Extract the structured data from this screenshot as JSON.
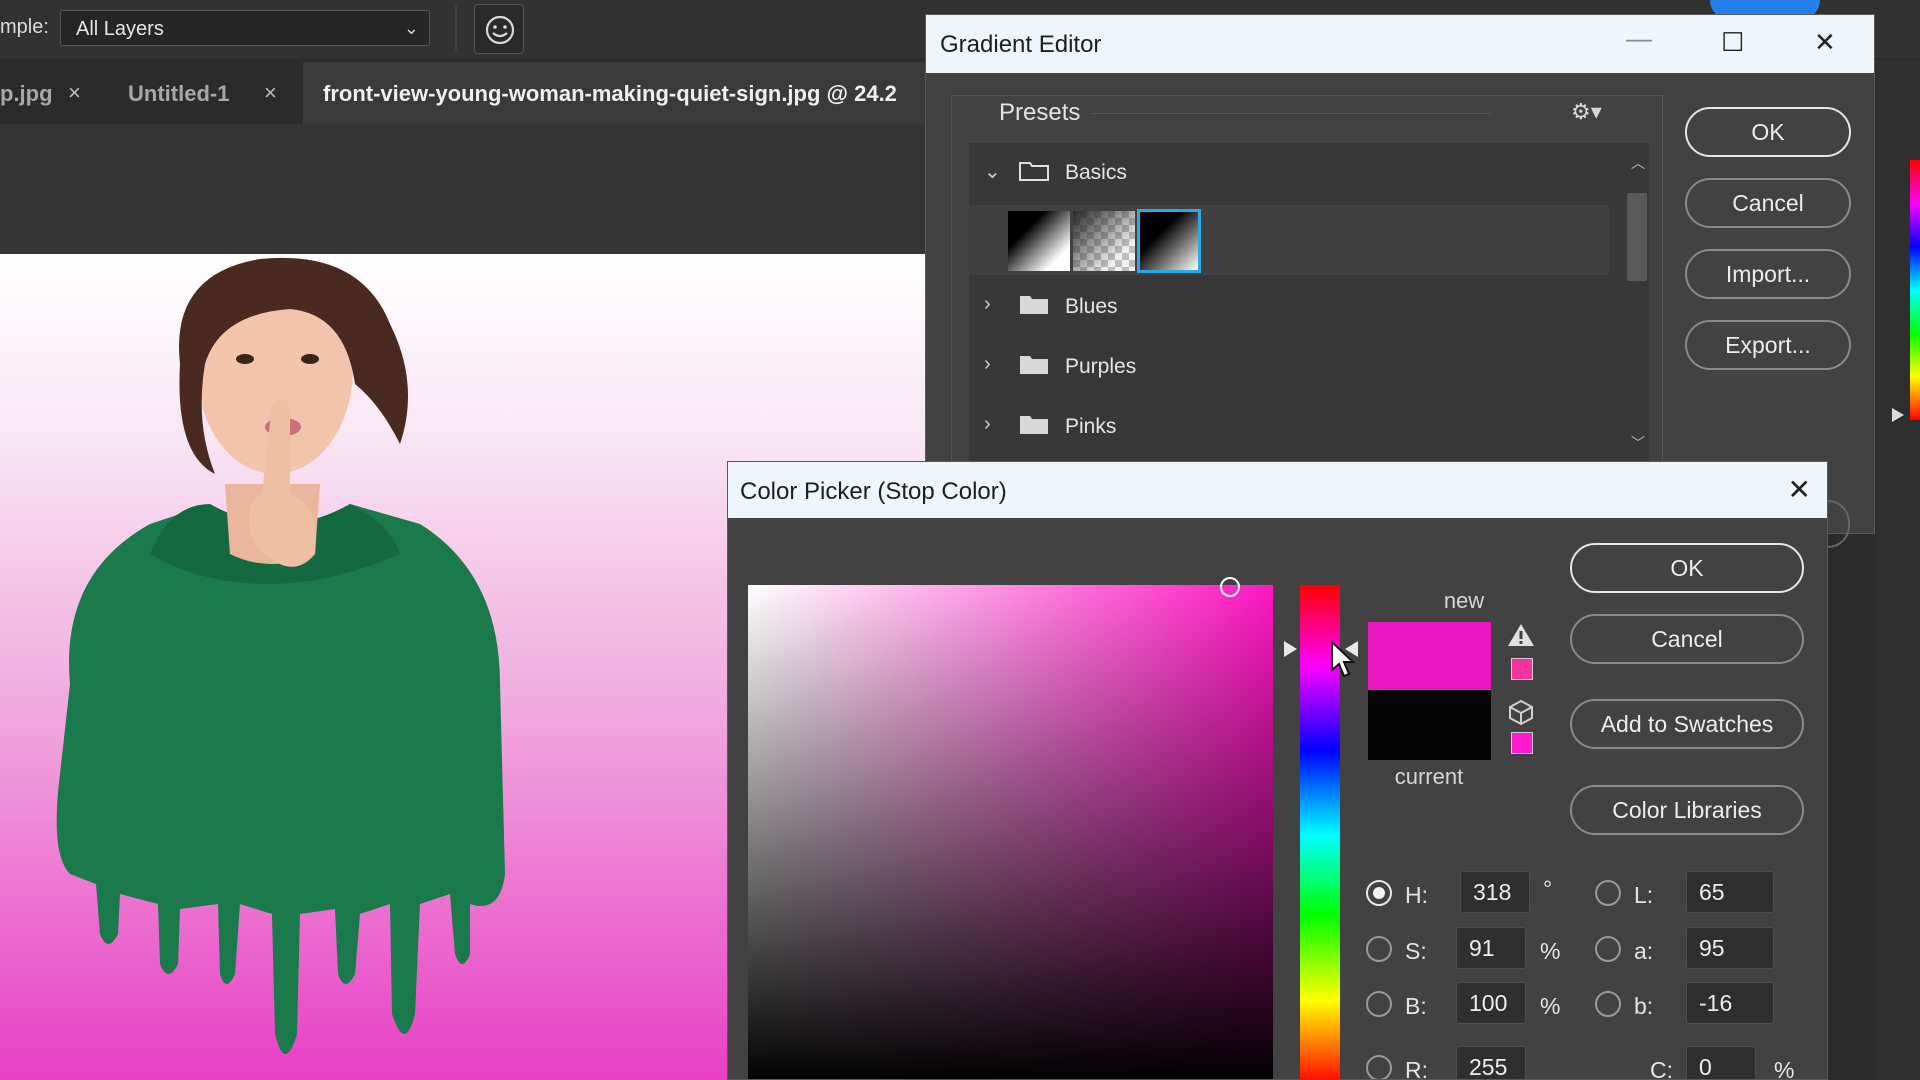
{
  "options_bar": {
    "sample_label": "mple:",
    "layers_select_value": "All Layers"
  },
  "tabs": [
    {
      "label": "p.jpg",
      "close": "×"
    },
    {
      "label": "Untitled-1",
      "close": "×"
    },
    {
      "label": "front-view-young-woman-making-quiet-sign.jpg @ 24.2"
    }
  ],
  "gradient_editor": {
    "title": "Gradient Editor",
    "presets_label": "Presets",
    "folders": [
      {
        "label": "Basics",
        "expanded": true
      },
      {
        "label": "Blues",
        "expanded": false
      },
      {
        "label": "Purples",
        "expanded": false
      },
      {
        "label": "Pinks",
        "expanded": false
      }
    ],
    "buttons": {
      "ok": "OK",
      "cancel": "Cancel",
      "import": "Import...",
      "export": "Export..."
    }
  },
  "color_picker": {
    "title": "Color Picker (Stop Color)",
    "new_label": "new",
    "current_label": "current",
    "new_color": "#e817c0",
    "current_color": "#050505",
    "buttons": {
      "ok": "OK",
      "cancel": "Cancel",
      "add_to_swatches": "Add to Swatches",
      "color_libraries": "Color Libraries"
    },
    "fields": {
      "H": {
        "label": "H:",
        "value": "318",
        "unit": "°",
        "selected": true
      },
      "S": {
        "label": "S:",
        "value": "91",
        "unit": "%"
      },
      "B": {
        "label": "B:",
        "value": "100",
        "unit": "%"
      },
      "R": {
        "label": "R:",
        "value": "255"
      },
      "L": {
        "label": "L:",
        "value": "65"
      },
      "a": {
        "label": "a:",
        "value": "95"
      },
      "b": {
        "label": "b:",
        "value": "-16"
      },
      "C": {
        "label": "C:",
        "value": "0",
        "unit": "%"
      }
    }
  },
  "colors": {
    "accent_blue": "#2680eb",
    "selected_swatch_border": "#2aa8e8",
    "hoodie_green": "#1a7a4c",
    "canvas_pink": "#e83fc5"
  },
  "icons": {
    "face_button": "face-select-icon",
    "gear": "gear-icon",
    "warning": "warning-triangle-icon",
    "web_safe": "cube-icon"
  }
}
